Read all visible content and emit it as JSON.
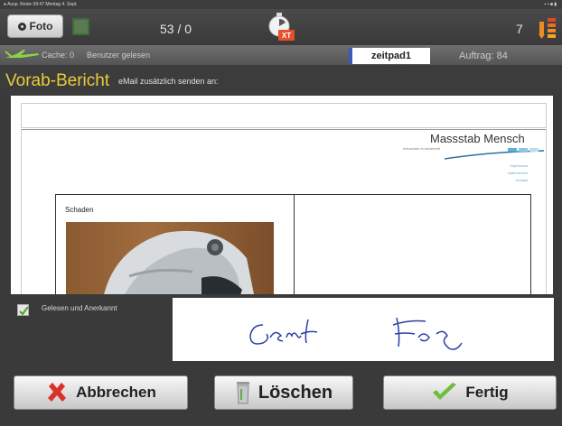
{
  "status_bar": {
    "left": "● Ausp. Reise  09:47  Montag 4. Sept.",
    "right": "▪ ▪ ■ ▮"
  },
  "toolbar": {
    "foto_label": "Foto",
    "counter": "53 / 0",
    "right_count": "7"
  },
  "info_bar": {
    "cache": "Cache: 0",
    "user": "Benutzer gelesen",
    "device": "zeitpad1",
    "auftrag": "Auftrag: 84"
  },
  "title": {
    "main": "Vorab-Bericht",
    "email_label": "eMail zusätzlich senden an:"
  },
  "document": {
    "brand": "Massstab Mensch",
    "brand_sub": "menschen in sicherheit",
    "brand_links": [
      "Impressum",
      "Datenschutz",
      "Kontakt"
    ],
    "schaden_label": "Schaden"
  },
  "bottom": {
    "checkbox_label": "Gelesen und Anerkannt",
    "checked": true
  },
  "buttons": {
    "cancel": "Abbrechen",
    "delete": "Löschen",
    "done": "Fertig"
  },
  "colors": {
    "title_yellow": "#e8cd3a",
    "accent_blue": "#3a5bbd",
    "cancel_red": "#d9312b",
    "done_green": "#6cbf3a"
  }
}
